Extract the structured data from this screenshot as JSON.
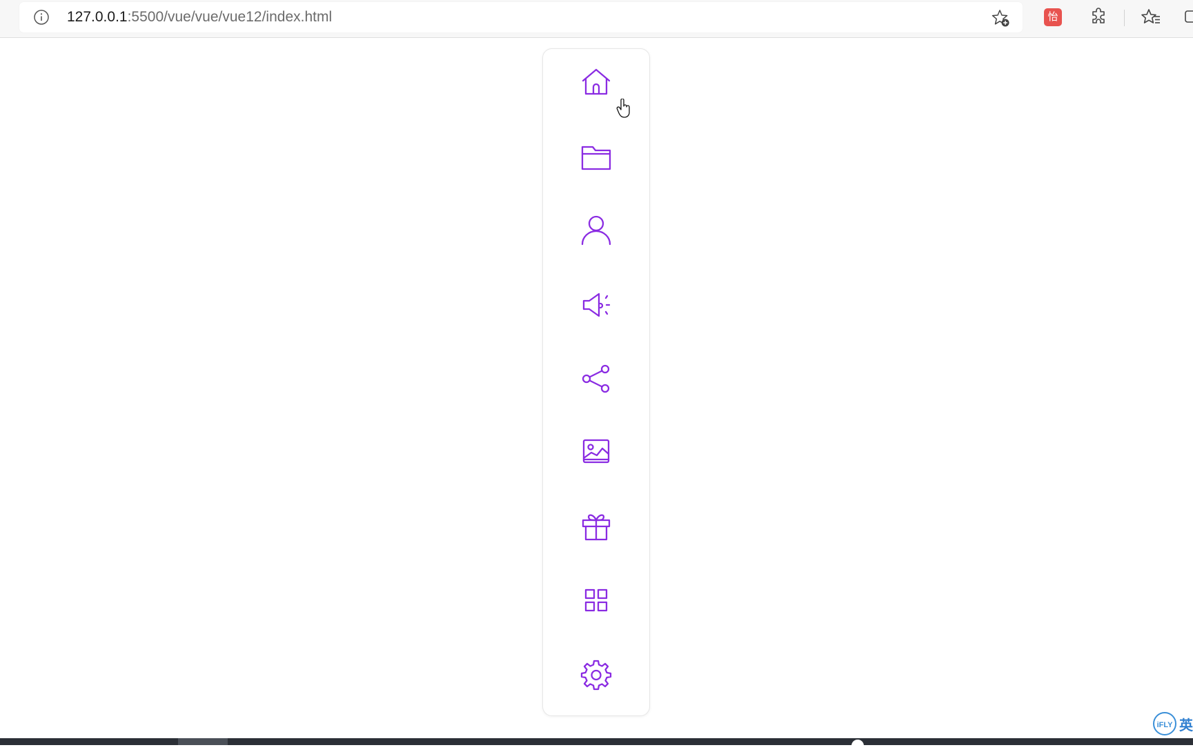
{
  "browser": {
    "url_host": "127.0.0.1",
    "url_path": ":5500/vue/vue/vue12/index.html",
    "extension_badge": "怡"
  },
  "nav": {
    "accent_color": "#8a2be2",
    "items": [
      {
        "icon": "home-icon",
        "label": "home"
      },
      {
        "icon": "folder-icon",
        "label": "folder"
      },
      {
        "icon": "user-icon",
        "label": "user"
      },
      {
        "icon": "megaphone-icon",
        "label": "announcement"
      },
      {
        "icon": "share-icon",
        "label": "share"
      },
      {
        "icon": "image-icon",
        "label": "image"
      },
      {
        "icon": "gift-icon",
        "label": "gift"
      },
      {
        "icon": "grid-icon",
        "label": "apps"
      },
      {
        "icon": "gear-icon",
        "label": "settings"
      }
    ]
  },
  "ime": {
    "logo_text": "iFLY",
    "language": "英"
  }
}
